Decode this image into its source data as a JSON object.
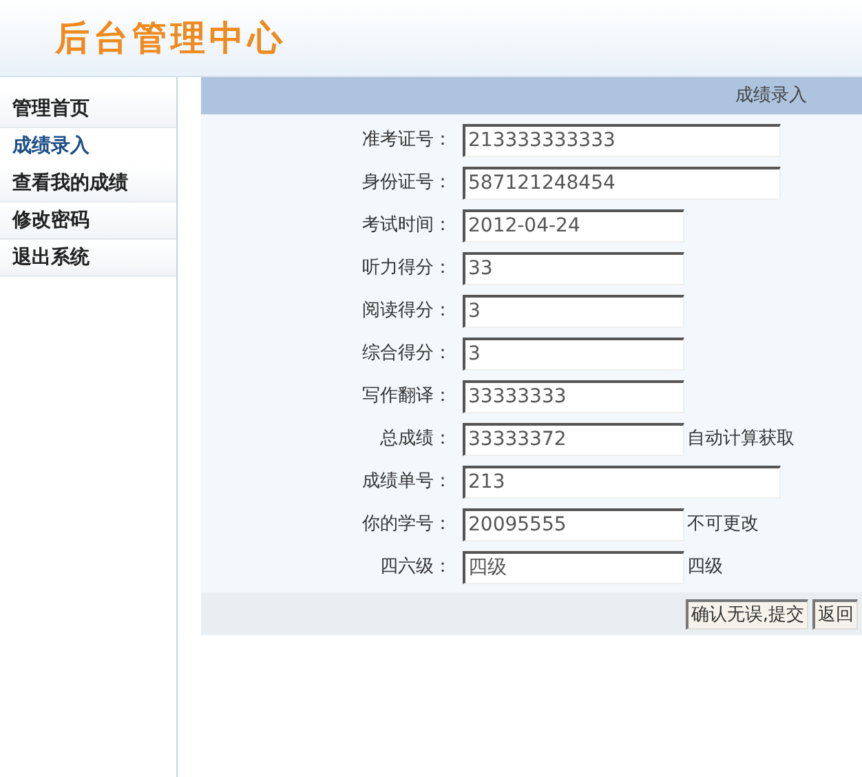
{
  "header": {
    "title": "后台管理中心"
  },
  "sidebar": {
    "items": [
      {
        "label": "管理首页",
        "selected": false
      },
      {
        "label": "成绩录入",
        "selected": true
      },
      {
        "label": "查看我的成绩",
        "selected": false
      },
      {
        "label": "修改密码",
        "selected": false
      },
      {
        "label": "退出系统",
        "selected": false
      }
    ]
  },
  "panel": {
    "title": "成绩录入",
    "fields": [
      {
        "label": "准考证号：",
        "value": "213333333333",
        "kind": "wide"
      },
      {
        "label": "身份证号：",
        "value": "587121248454",
        "kind": "wide"
      },
      {
        "label": "考试时间：",
        "value": "2012-04-24",
        "kind": "narrow"
      },
      {
        "label": "听力得分：",
        "value": "33",
        "kind": "narrow"
      },
      {
        "label": "阅读得分：",
        "value": "3",
        "kind": "narrow"
      },
      {
        "label": "综合得分：",
        "value": "3",
        "kind": "narrow"
      },
      {
        "label": "写作翻译：",
        "value": "33333333",
        "kind": "narrow"
      },
      {
        "label": "总成绩：",
        "value": "33333372",
        "kind": "narrow",
        "note": "自动计算获取"
      },
      {
        "label": "成绩单号：",
        "value": "213",
        "kind": "wide"
      },
      {
        "label": "你的学号：",
        "value": "20095555",
        "kind": "narrow",
        "note": "不可更改"
      },
      {
        "label": "四六级：",
        "value": "四级",
        "kind": "narrow",
        "note": "四级"
      }
    ],
    "buttons": [
      "确认无误,提交",
      "返回"
    ]
  }
}
